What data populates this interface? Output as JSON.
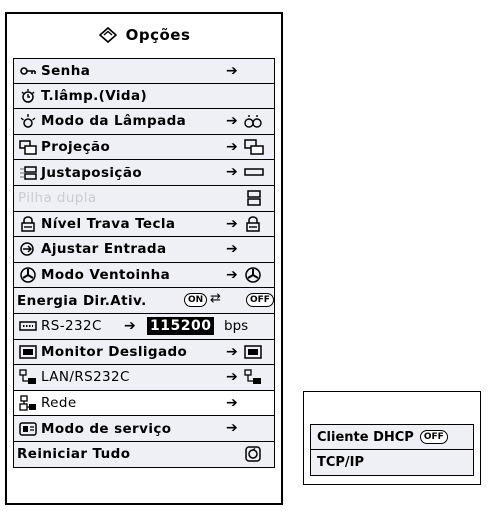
{
  "menu": {
    "title": "Opções",
    "title_icon": "options-icon",
    "items": [
      {
        "label": "Senha",
        "icon": "key-icon",
        "arrow": "➔"
      },
      {
        "label": "T.lâmp.(Vida)",
        "icon": "lamp-timer-icon"
      },
      {
        "label": "Modo da Lâmpada",
        "icon": "lamp-icon",
        "arrow": "➔"
      },
      {
        "label": "Projeção",
        "icon": "projection-icon",
        "arrow": "➔"
      },
      {
        "label": "Justaposição",
        "icon": "stack-icon",
        "arrow": "➔"
      },
      {
        "label": "Pilha dupla",
        "icon": "dual-stack-icon"
      },
      {
        "label": "Nível Trava Tecla",
        "icon": "lock-icon",
        "arrow": "➔"
      },
      {
        "label": "Ajustar Entrada",
        "icon": "input-adjust-icon",
        "arrow": "➔"
      },
      {
        "label": "Modo Ventoinha",
        "icon": "fan-icon",
        "arrow": "➔"
      },
      {
        "label": "Energia Dir.Ativ.",
        "badge_on": "ON",
        "badge_off": "OFF"
      },
      {
        "label": "RS-232C",
        "icon": "serial-port-icon",
        "arrow": "➔",
        "value": "115200",
        "unit": "bps"
      },
      {
        "label": "Monitor Desligado",
        "icon": "monitor-icon",
        "arrow": "➔"
      },
      {
        "label": "LAN/RS232C",
        "icon": "lan-icon",
        "arrow": "➔"
      },
      {
        "label": "Rede",
        "icon": "network-icon",
        "arrow": "➔"
      },
      {
        "label": "Modo de serviço",
        "icon": "service-icon",
        "arrow": "➔"
      },
      {
        "label": "Reiniciar Tudo",
        "icon": "reset-icon"
      }
    ]
  },
  "submenu": {
    "items": [
      {
        "label": "Cliente DHCP",
        "badge": "OFF"
      },
      {
        "label": "TCP/IP"
      }
    ]
  }
}
